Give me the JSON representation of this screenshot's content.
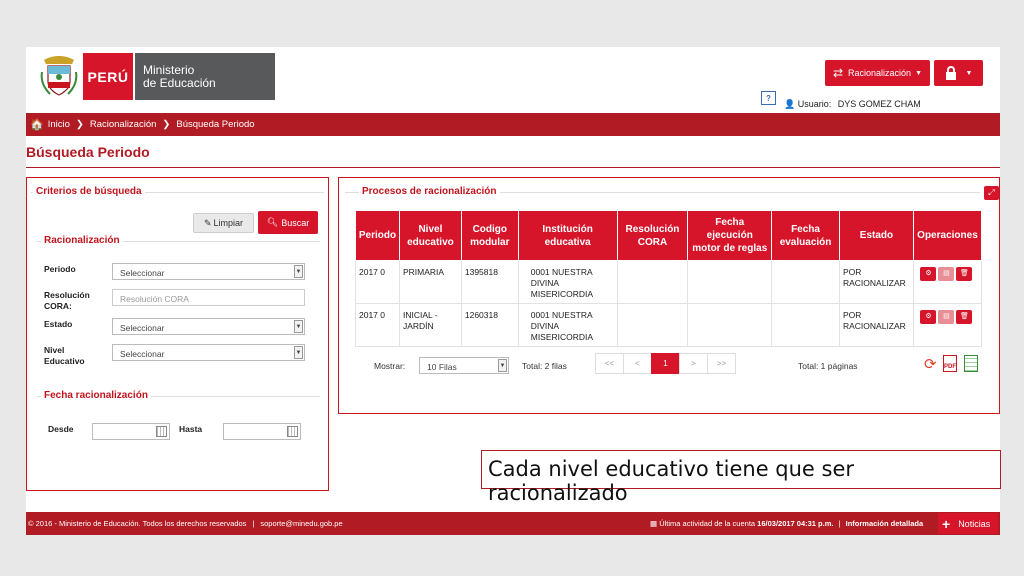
{
  "header": {
    "country": "PERÚ",
    "ministry_line1": "Ministerio",
    "ministry_line2": "de Educación",
    "module_button": "Racionalización",
    "help": "?",
    "user_label": "Usuario:",
    "user_name": "DYS GOMEZ CHAM"
  },
  "breadcrumb": {
    "home": "Inicio",
    "level1": "Racionalización",
    "level2": "Búsqueda Periodo"
  },
  "page_title": "Búsqueda Periodo",
  "criteria": {
    "title": "Criterios de búsqueda",
    "clear_label": "Limpiar",
    "search_label": "Buscar",
    "section_racionalizacion": "Racionalización",
    "periodo_label": "Periodo",
    "periodo_value": "Seleccionar",
    "resolucion_label_1": "Resolución",
    "resolucion_label_2": "CORA:",
    "resolucion_placeholder": "Resolución CORA",
    "estado_label": "Estado",
    "estado_value": "Seleccionar",
    "nivel_label_1": "Nivel",
    "nivel_label_2": "Educativo",
    "nivel_value": "Seleccionar",
    "section_fecha": "Fecha racionalización",
    "desde_label": "Desde",
    "hasta_label": "Hasta"
  },
  "processes": {
    "title": "Procesos de racionalización",
    "columns": [
      [
        "Periodo"
      ],
      [
        "Nivel",
        "educativo"
      ],
      [
        "Codigo",
        "modular"
      ],
      [
        "Institución",
        "educativa"
      ],
      [
        "Resolución",
        "CORA"
      ],
      [
        "Fecha",
        "ejecución",
        "motor de reglas"
      ],
      [
        "Fecha",
        "evaluación"
      ],
      [
        "Estado"
      ],
      [
        "Operaciones"
      ]
    ],
    "rows": [
      {
        "periodo": "2017 0",
        "nivel": [
          "PRIMARIA"
        ],
        "codigo": "1395818",
        "institucion": [
          "0001 NUESTRA",
          "DIVINA",
          "MISERICORDIA"
        ],
        "resolucion": "",
        "fecha_motor": "",
        "fecha_eval": "",
        "estado": [
          "POR",
          "RACIONALIZAR"
        ]
      },
      {
        "periodo": "2017 0",
        "nivel": [
          "INICIAL -",
          "JARDÍN"
        ],
        "codigo": "1260318",
        "institucion": [
          "0001 NUESTRA",
          "DIVINA",
          "MISERICORDIA"
        ],
        "resolucion": "",
        "fecha_motor": "",
        "fecha_eval": "",
        "estado": [
          "POR",
          "RACIONALIZAR"
        ]
      }
    ],
    "show_label": "Mostrar:",
    "show_value": "10 Filas",
    "total_rows": "Total: 2 filas",
    "pager": [
      "<<",
      "<",
      "1",
      ">",
      ">>"
    ],
    "active_page": "1",
    "total_pages": "Total: 1 páginas"
  },
  "caption": "Cada nivel educativo tiene que ser racionalizado",
  "footer": {
    "copyright": "© 2016 - Ministerio de Educación. Todos los derechos reservados",
    "separator": "|",
    "email": "soporte@minedu.gob.pe",
    "activity_label": "Última actividad de la cuenta",
    "activity_date": "16/03/2017 04:31 p.m.",
    "details": "Información detallada",
    "news": "Noticias"
  },
  "colors": {
    "brand_red": "#d6152b",
    "bar_red": "#b11b23",
    "ministry_gray": "#58595b"
  }
}
